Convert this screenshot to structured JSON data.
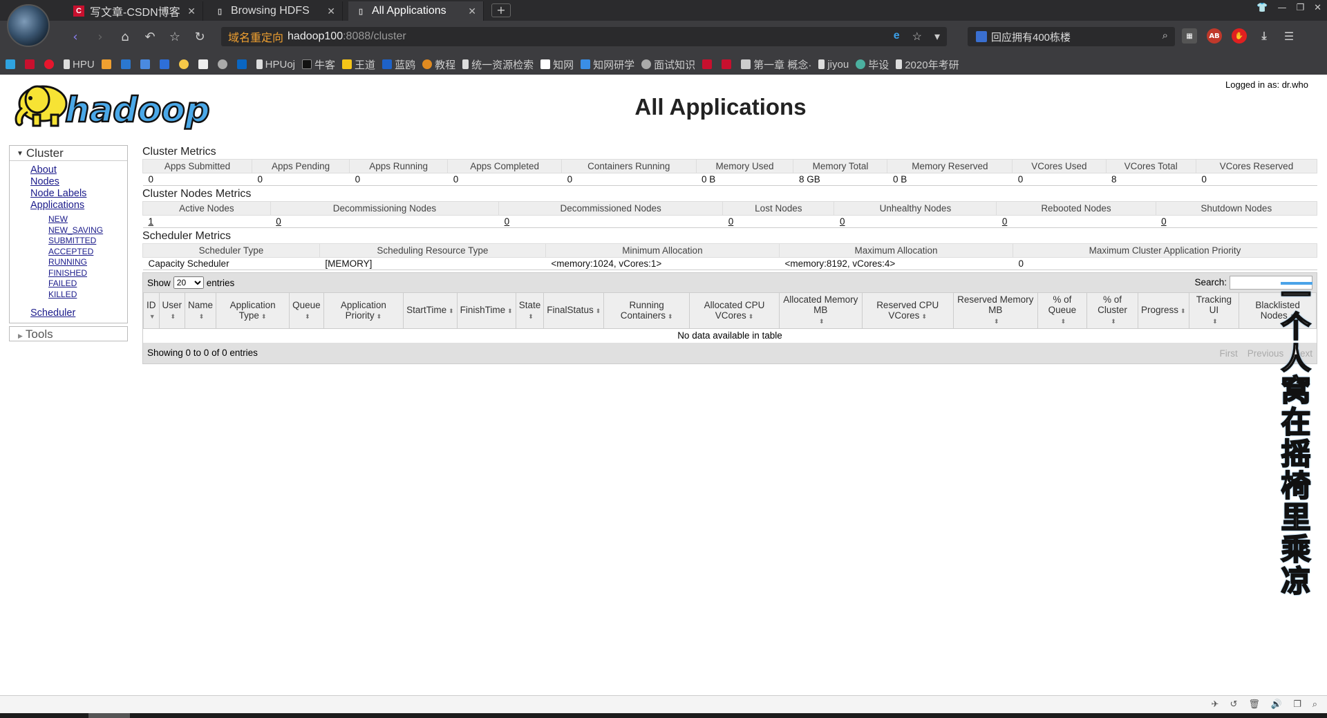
{
  "browser": {
    "tabs": [
      {
        "label": "写文章-CSDN博客",
        "icon": "csdn-icon",
        "active": false
      },
      {
        "label": "Browsing HDFS",
        "icon": "page-icon",
        "active": false
      },
      {
        "label": "All Applications",
        "icon": "page-icon",
        "active": true
      }
    ],
    "address": {
      "redirect_label": "域名重定向",
      "host": "hadoop100",
      "path": ":8088/cluster"
    },
    "search_box": "回应拥有400栋楼",
    "bookmarks": [
      "HPU",
      "HPUoj",
      "牛客",
      "王道",
      "蓝鸥",
      "教程",
      "统一资源检索",
      "知网",
      "知网研学",
      "面试知识",
      "第一章 概念·",
      "jiyou",
      "毕设",
      "2020年考研"
    ]
  },
  "page": {
    "title": "All Applications",
    "logged_in": "Logged in as: dr.who",
    "logo_text": "hadoop"
  },
  "nav": {
    "cluster_label": "Cluster",
    "links": [
      "About",
      "Nodes",
      "Node Labels",
      "Applications"
    ],
    "app_states": [
      "NEW",
      "NEW_SAVING",
      "SUBMITTED",
      "ACCEPTED",
      "RUNNING",
      "FINISHED",
      "FAILED",
      "KILLED"
    ],
    "scheduler": "Scheduler",
    "tools_label": "Tools"
  },
  "cluster_metrics": {
    "title": "Cluster Metrics",
    "headers": [
      "Apps Submitted",
      "Apps Pending",
      "Apps Running",
      "Apps Completed",
      "Containers Running",
      "Memory Used",
      "Memory Total",
      "Memory Reserved",
      "VCores Used",
      "VCores Total",
      "VCores Reserved"
    ],
    "values": [
      "0",
      "0",
      "0",
      "0",
      "0",
      "0 B",
      "8 GB",
      "0 B",
      "0",
      "8",
      "0"
    ]
  },
  "node_metrics": {
    "title": "Cluster Nodes Metrics",
    "headers": [
      "Active Nodes",
      "Decommissioning Nodes",
      "Decommissioned Nodes",
      "Lost Nodes",
      "Unhealthy Nodes",
      "Rebooted Nodes",
      "Shutdown Nodes"
    ],
    "values": [
      "1",
      "0",
      "0",
      "0",
      "0",
      "0",
      "0"
    ]
  },
  "scheduler_metrics": {
    "title": "Scheduler Metrics",
    "headers": [
      "Scheduler Type",
      "Scheduling Resource Type",
      "Minimum Allocation",
      "Maximum Allocation",
      "Maximum Cluster Application Priority"
    ],
    "values": [
      "Capacity Scheduler",
      "[MEMORY]",
      "<memory:1024, vCores:1>",
      "<memory:8192, vCores:4>",
      "0"
    ]
  },
  "apps_table": {
    "show_label": "Show",
    "entries_value": "20",
    "entries_label": "entries",
    "search_label": "Search:",
    "headers": [
      "ID",
      "User",
      "Name",
      "Application Type",
      "Queue",
      "Application Priority",
      "StartTime",
      "FinishTime",
      "State",
      "FinalStatus",
      "Running Containers",
      "Allocated CPU VCores",
      "Allocated Memory MB",
      "Reserved CPU VCores",
      "Reserved Memory MB",
      "% of Queue",
      "% of Cluster",
      "Progress",
      "Tracking UI",
      "Blacklisted Nodes"
    ],
    "empty_text": "No data available in table",
    "showing_text": "Showing 0 to 0 of 0 entries",
    "pager": [
      "First",
      "Previous",
      "Next"
    ]
  },
  "watermark": "一个人窝在摇椅里乘凉"
}
